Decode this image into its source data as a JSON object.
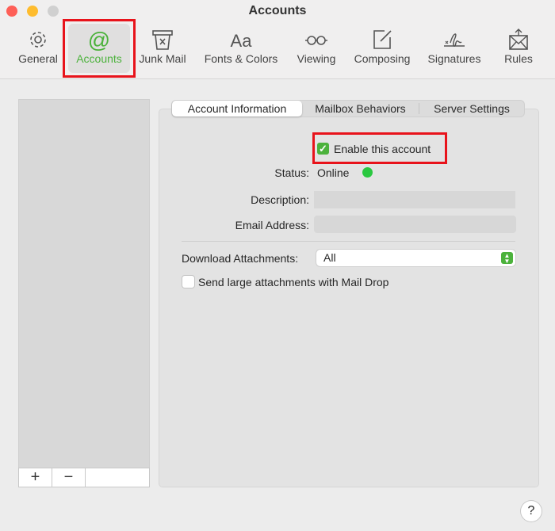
{
  "window": {
    "title": "Accounts"
  },
  "toolbar": {
    "items": [
      {
        "label": "General",
        "icon": "gear-icon"
      },
      {
        "label": "Accounts",
        "icon": "at-icon"
      },
      {
        "label": "Junk Mail",
        "icon": "junk-bin-icon"
      },
      {
        "label": "Fonts & Colors",
        "icon": "font-icon"
      },
      {
        "label": "Viewing",
        "icon": "glasses-icon"
      },
      {
        "label": "Composing",
        "icon": "compose-icon"
      },
      {
        "label": "Signatures",
        "icon": "signature-icon"
      },
      {
        "label": "Rules",
        "icon": "rules-envelope-icon"
      }
    ],
    "selected": "Accounts",
    "accent": "#4cb23c"
  },
  "sidebar": {
    "add_label": "+",
    "remove_label": "−"
  },
  "tabs": [
    {
      "label": "Account Information"
    },
    {
      "label": "Mailbox Behaviors"
    },
    {
      "label": "Server Settings"
    }
  ],
  "form": {
    "enable_label": "Enable this account",
    "enable_checked": true,
    "status_label": "Status:",
    "status_value": "Online",
    "status_color": "#2ac840",
    "description_label": "Description:",
    "description_value": "",
    "email_label": "Email Address:",
    "email_value": "",
    "download_label": "Download Attachments:",
    "download_value": "All",
    "maildrop_label": "Send large attachments with Mail Drop",
    "maildrop_checked": false
  },
  "help": {
    "label": "?"
  }
}
